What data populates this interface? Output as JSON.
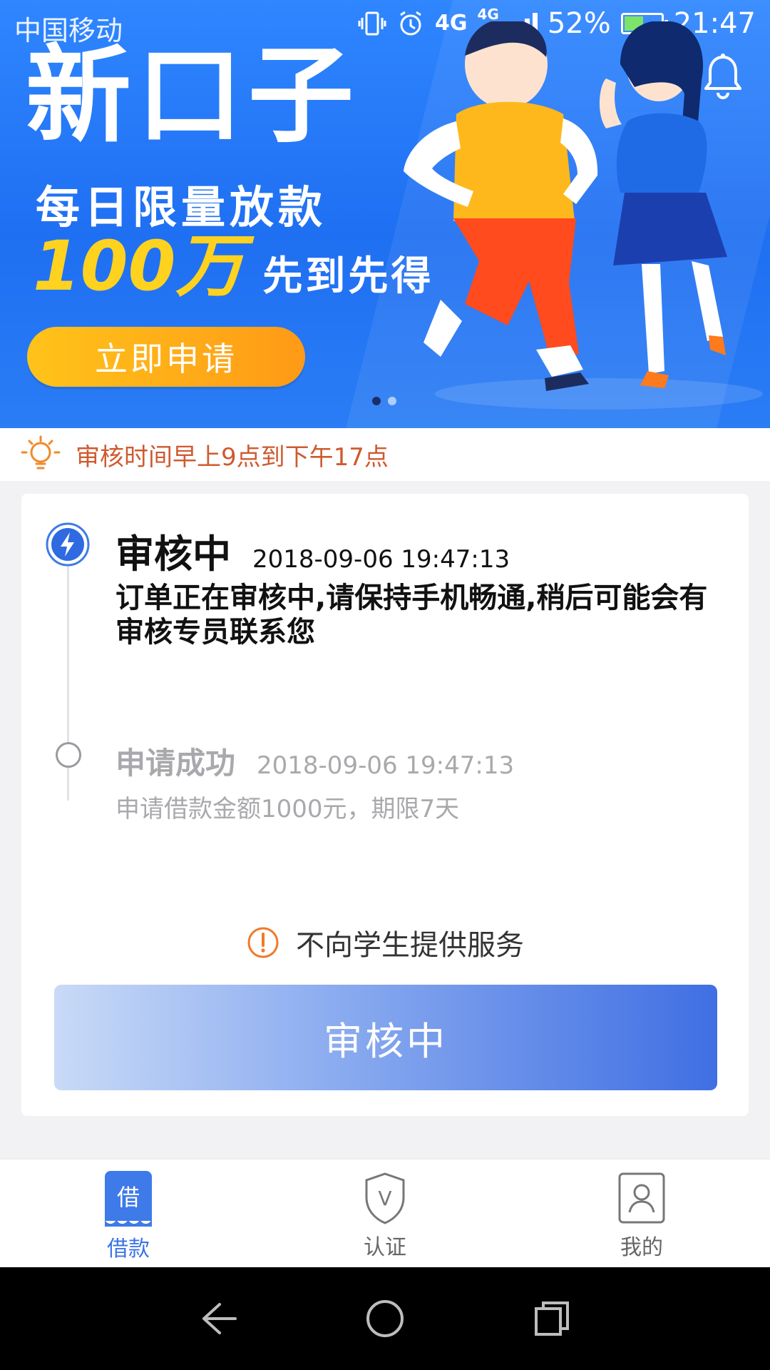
{
  "status_bar": {
    "carrier": "中国移动",
    "network_1": "4G",
    "network_2": "4G",
    "battery_percent": "52%",
    "battery_level": 0.52,
    "time": "21:47"
  },
  "banner": {
    "headline": "新口子",
    "subtitle": "每日限量放款",
    "amount": "100万",
    "slogan": "先到先得",
    "cta_label": "立即申请",
    "page_count": 2,
    "active_page": 1
  },
  "notice": {
    "text": "审核时间早上9点到下午17点"
  },
  "timeline": [
    {
      "title": "审核中",
      "datetime": "2018-09-06 19:47:13",
      "description": "订单正在审核中,请保持手机畅通,稍后可能会有审核专员联系您",
      "active": true
    },
    {
      "title": "申请成功",
      "datetime": "2018-09-06 19:47:13",
      "description": "申请借款金额1000元，期限7天",
      "active": false
    }
  ],
  "warning": {
    "text": "不向学生提供服务"
  },
  "status_button": {
    "label": "审核中"
  },
  "bottom_nav": {
    "items": [
      {
        "label": "借款",
        "icon_text": "借",
        "icon": "loan-icon",
        "active": true
      },
      {
        "label": "认证",
        "icon_text": "V",
        "icon": "shield-icon",
        "active": false
      },
      {
        "label": "我的",
        "icon": "user-icon",
        "active": false
      }
    ]
  },
  "colors": {
    "brand_blue": "#3e7ae8",
    "banner_blue": "#2a7df5",
    "notice_orange": "#cf5a2f",
    "cta_yellow": "#ffc31a"
  }
}
